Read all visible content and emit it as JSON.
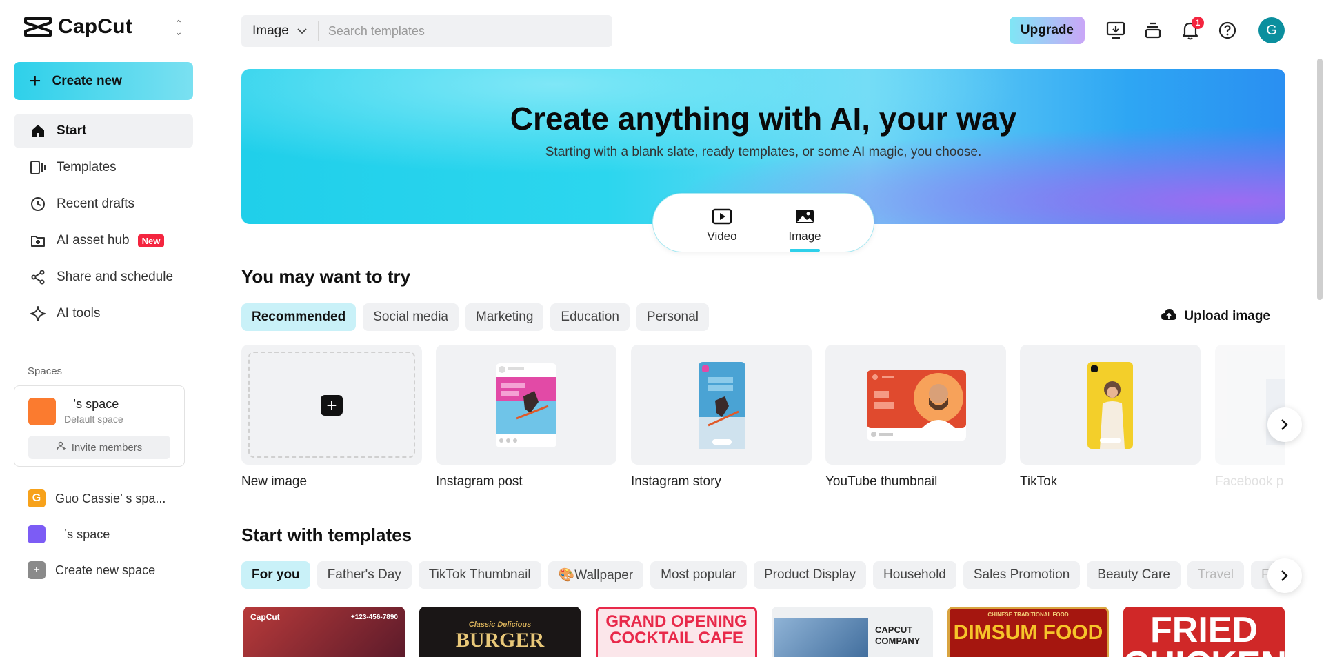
{
  "app": {
    "name": "CapCut"
  },
  "sidebar": {
    "create_label": "Create new",
    "nav": [
      {
        "label": "Start",
        "icon": "home-icon",
        "active": true
      },
      {
        "label": "Templates",
        "icon": "templates-icon"
      },
      {
        "label": "Recent drafts",
        "icon": "clock-icon"
      },
      {
        "label": "AI asset hub",
        "icon": "asset-hub-icon",
        "badge": "New"
      },
      {
        "label": "Share and schedule",
        "icon": "share-icon"
      },
      {
        "label": "AI tools",
        "icon": "sparkle-icon"
      }
    ],
    "spaces_heading": "Spaces",
    "space_card": {
      "name": "⠀’s space",
      "subtitle": "Default space",
      "invite_label": "Invite members"
    },
    "space_list": [
      {
        "label": "Guo Cassie’ s spa...",
        "initial": "G",
        "color": "#f7a21b"
      },
      {
        "label": "⠀’s space",
        "initial": "",
        "color": "#7c5cf5"
      },
      {
        "label": "Create new space",
        "initial": "+",
        "color": "#8a8a8a"
      }
    ]
  },
  "topbar": {
    "search_type": "Image",
    "search_placeholder": "Search templates",
    "upgrade_label": "Upgrade",
    "notification_count": "1",
    "avatar_initial": "G"
  },
  "hero": {
    "title": "Create anything with AI, your way",
    "subtitle": "Starting with a blank slate, ready templates, or some AI magic, you choose.",
    "modes": [
      {
        "label": "Video",
        "icon": "video-play-icon",
        "active": false
      },
      {
        "label": "Image",
        "icon": "image-icon",
        "active": true
      }
    ]
  },
  "try_section": {
    "title": "You may want to try",
    "chips": [
      "Recommended",
      "Social media",
      "Marketing",
      "Education",
      "Personal"
    ],
    "active_chip": "Recommended",
    "upload_label": "Upload image",
    "cards": [
      {
        "label": "New image"
      },
      {
        "label": "Instagram post"
      },
      {
        "label": "Instagram story"
      },
      {
        "label": "YouTube thumbnail"
      },
      {
        "label": "TikTok"
      },
      {
        "label": "Facebook p"
      }
    ]
  },
  "templates_section": {
    "title": "Start with templates",
    "chips": [
      "For you",
      "Father's Day",
      "TikTok Thumbnail",
      "🎨Wallpaper",
      "Most popular",
      "Product Display",
      "Household",
      "Sales Promotion",
      "Beauty Care",
      "Travel",
      "Foo"
    ],
    "active_chip": "For you",
    "templates": [
      {
        "text_a": "CapCut",
        "text_b": "+123-456-7890"
      },
      {
        "text_a": "Classic Delicious",
        "text_b": "BURGER"
      },
      {
        "text_a": "GRAND OPENING",
        "text_b": "COCKTAIL CAFE"
      },
      {
        "text_a": "CAPCUT",
        "text_b": "COMPANY"
      },
      {
        "text_a": "CHINESE TRADITIONAL FOOD",
        "text_b": "DIMSUM FOOD"
      },
      {
        "text_a": "FRIED",
        "text_b": "CHICKEN"
      }
    ]
  }
}
